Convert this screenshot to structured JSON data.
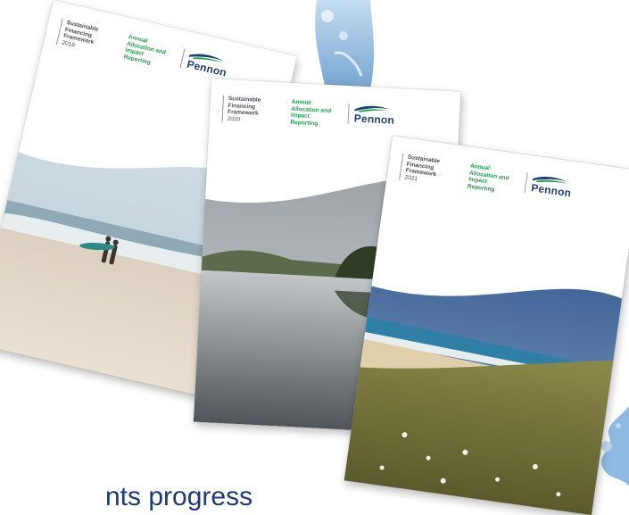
{
  "brand": {
    "name": "Pennon",
    "primary_color": "#1f3f79",
    "accent_color": "#1fa046"
  },
  "covers": [
    {
      "framework_label": "Sustainable Financing Framework",
      "year": "2019",
      "report_label": "Annual Allocation and Impact Reporting",
      "brand": "Pennon"
    },
    {
      "framework_label": "Sustainable Financing Framework",
      "year": "2020",
      "report_label": "Annual Allocation and Impact Reporting",
      "brand": "Pennon"
    },
    {
      "framework_label": "Sustainable Financing Framework",
      "year": "2021",
      "report_label": "Annual Allocation and Impact Reporting",
      "brand": "Pennon"
    }
  ],
  "tagline": "nts progress"
}
